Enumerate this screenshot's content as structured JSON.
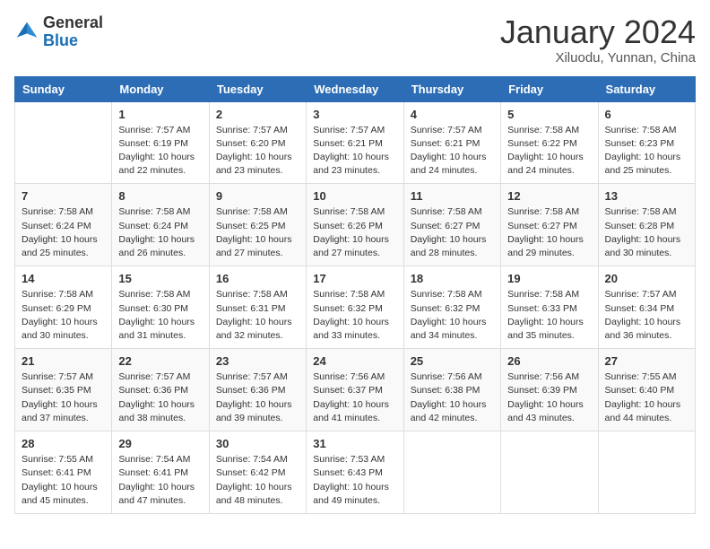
{
  "header": {
    "logo_general": "General",
    "logo_blue": "Blue",
    "month_title": "January 2024",
    "subtitle": "Xiluodu, Yunnan, China"
  },
  "columns": [
    "Sunday",
    "Monday",
    "Tuesday",
    "Wednesday",
    "Thursday",
    "Friday",
    "Saturday"
  ],
  "weeks": [
    [
      {
        "day": "",
        "info": ""
      },
      {
        "day": "1",
        "info": "Sunrise: 7:57 AM\nSunset: 6:19 PM\nDaylight: 10 hours\nand 22 minutes."
      },
      {
        "day": "2",
        "info": "Sunrise: 7:57 AM\nSunset: 6:20 PM\nDaylight: 10 hours\nand 23 minutes."
      },
      {
        "day": "3",
        "info": "Sunrise: 7:57 AM\nSunset: 6:21 PM\nDaylight: 10 hours\nand 23 minutes."
      },
      {
        "day": "4",
        "info": "Sunrise: 7:57 AM\nSunset: 6:21 PM\nDaylight: 10 hours\nand 24 minutes."
      },
      {
        "day": "5",
        "info": "Sunrise: 7:58 AM\nSunset: 6:22 PM\nDaylight: 10 hours\nand 24 minutes."
      },
      {
        "day": "6",
        "info": "Sunrise: 7:58 AM\nSunset: 6:23 PM\nDaylight: 10 hours\nand 25 minutes."
      }
    ],
    [
      {
        "day": "7",
        "info": "Sunrise: 7:58 AM\nSunset: 6:24 PM\nDaylight: 10 hours\nand 25 minutes."
      },
      {
        "day": "8",
        "info": "Sunrise: 7:58 AM\nSunset: 6:24 PM\nDaylight: 10 hours\nand 26 minutes."
      },
      {
        "day": "9",
        "info": "Sunrise: 7:58 AM\nSunset: 6:25 PM\nDaylight: 10 hours\nand 27 minutes."
      },
      {
        "day": "10",
        "info": "Sunrise: 7:58 AM\nSunset: 6:26 PM\nDaylight: 10 hours\nand 27 minutes."
      },
      {
        "day": "11",
        "info": "Sunrise: 7:58 AM\nSunset: 6:27 PM\nDaylight: 10 hours\nand 28 minutes."
      },
      {
        "day": "12",
        "info": "Sunrise: 7:58 AM\nSunset: 6:27 PM\nDaylight: 10 hours\nand 29 minutes."
      },
      {
        "day": "13",
        "info": "Sunrise: 7:58 AM\nSunset: 6:28 PM\nDaylight: 10 hours\nand 30 minutes."
      }
    ],
    [
      {
        "day": "14",
        "info": "Sunrise: 7:58 AM\nSunset: 6:29 PM\nDaylight: 10 hours\nand 30 minutes."
      },
      {
        "day": "15",
        "info": "Sunrise: 7:58 AM\nSunset: 6:30 PM\nDaylight: 10 hours\nand 31 minutes."
      },
      {
        "day": "16",
        "info": "Sunrise: 7:58 AM\nSunset: 6:31 PM\nDaylight: 10 hours\nand 32 minutes."
      },
      {
        "day": "17",
        "info": "Sunrise: 7:58 AM\nSunset: 6:32 PM\nDaylight: 10 hours\nand 33 minutes."
      },
      {
        "day": "18",
        "info": "Sunrise: 7:58 AM\nSunset: 6:32 PM\nDaylight: 10 hours\nand 34 minutes."
      },
      {
        "day": "19",
        "info": "Sunrise: 7:58 AM\nSunset: 6:33 PM\nDaylight: 10 hours\nand 35 minutes."
      },
      {
        "day": "20",
        "info": "Sunrise: 7:57 AM\nSunset: 6:34 PM\nDaylight: 10 hours\nand 36 minutes."
      }
    ],
    [
      {
        "day": "21",
        "info": "Sunrise: 7:57 AM\nSunset: 6:35 PM\nDaylight: 10 hours\nand 37 minutes."
      },
      {
        "day": "22",
        "info": "Sunrise: 7:57 AM\nSunset: 6:36 PM\nDaylight: 10 hours\nand 38 minutes."
      },
      {
        "day": "23",
        "info": "Sunrise: 7:57 AM\nSunset: 6:36 PM\nDaylight: 10 hours\nand 39 minutes."
      },
      {
        "day": "24",
        "info": "Sunrise: 7:56 AM\nSunset: 6:37 PM\nDaylight: 10 hours\nand 41 minutes."
      },
      {
        "day": "25",
        "info": "Sunrise: 7:56 AM\nSunset: 6:38 PM\nDaylight: 10 hours\nand 42 minutes."
      },
      {
        "day": "26",
        "info": "Sunrise: 7:56 AM\nSunset: 6:39 PM\nDaylight: 10 hours\nand 43 minutes."
      },
      {
        "day": "27",
        "info": "Sunrise: 7:55 AM\nSunset: 6:40 PM\nDaylight: 10 hours\nand 44 minutes."
      }
    ],
    [
      {
        "day": "28",
        "info": "Sunrise: 7:55 AM\nSunset: 6:41 PM\nDaylight: 10 hours\nand 45 minutes."
      },
      {
        "day": "29",
        "info": "Sunrise: 7:54 AM\nSunset: 6:41 PM\nDaylight: 10 hours\nand 47 minutes."
      },
      {
        "day": "30",
        "info": "Sunrise: 7:54 AM\nSunset: 6:42 PM\nDaylight: 10 hours\nand 48 minutes."
      },
      {
        "day": "31",
        "info": "Sunrise: 7:53 AM\nSunset: 6:43 PM\nDaylight: 10 hours\nand 49 minutes."
      },
      {
        "day": "",
        "info": ""
      },
      {
        "day": "",
        "info": ""
      },
      {
        "day": "",
        "info": ""
      }
    ]
  ]
}
